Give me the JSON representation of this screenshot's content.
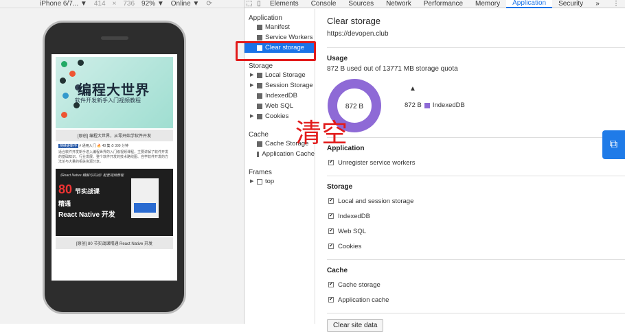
{
  "device_toolbar": {
    "device": "iPhone 6/7... ▼",
    "width": "414",
    "times": "×",
    "height": "736",
    "zoom": "92% ▼",
    "network": "Online ▼"
  },
  "phone": {
    "banner1_title": "编程大世界",
    "banner1_sub": "软件开发新手入门视频教程",
    "caption1": "[原创] 编程大世界，从零开始学软件开发",
    "meta_tag": "持续更新中",
    "meta_rest": "# 通用入门 🔥 40 集 ⏱ 300 分钟",
    "desc": "适合软件开发新手进入编程世界的入门级视频课程，主要讲解了软件开发的基础知识、行业发展、整个软件开发的技术路线图、自学软件开发的方法论与大量的相关资源分享。",
    "banner2_title": "《React Native 精解与实战》配套视频教程",
    "banner2_num": "80",
    "banner2_h1": "节实战课",
    "banner2_h2": "精通",
    "banner2_h3": "React Native 开发",
    "caption2": "[原创] 80 节实战课精通 React Native 开发"
  },
  "tabs": [
    "Elements",
    "Console",
    "Sources",
    "Network",
    "Performance",
    "Memory",
    "Application",
    "Security"
  ],
  "tabs_more": "»",
  "sidebar": {
    "application": "Application",
    "app_items": [
      "Manifest",
      "Service Workers",
      "Clear storage"
    ],
    "storage": "Storage",
    "storage_items": [
      "Local Storage",
      "Session Storage",
      "IndexedDB",
      "Web SQL",
      "Cookies"
    ],
    "cache": "Cache",
    "cache_items": [
      "Cache Storage",
      "Application Cache"
    ],
    "frames": "Frames",
    "frames_items": [
      "top"
    ]
  },
  "main": {
    "title": "Clear storage",
    "url": "https://devopen.club",
    "usage_header": "Usage",
    "usage_text": "872 B used out of 13771 MB storage quota",
    "donut_label": "872 B",
    "legend_value": "872 B",
    "legend_name": "IndexedDB",
    "application_header": "Application",
    "application_checks": [
      "Unregister service workers"
    ],
    "storage_header": "Storage",
    "storage_checks": [
      "Local and session storage",
      "IndexedDB",
      "Web SQL",
      "Cookies"
    ],
    "cache_header": "Cache",
    "cache_checks": [
      "Cache storage",
      "Application cache"
    ],
    "clear_button": "Clear site data"
  },
  "overlay_text": "清空",
  "colors": {
    "accent": "#1a73e8",
    "red": "#e21b1b",
    "donut": "#8e6ad6"
  }
}
